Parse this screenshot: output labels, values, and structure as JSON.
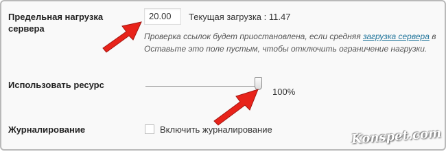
{
  "server_load": {
    "label": "Предельная нагрузка сервера",
    "value": "20.00",
    "current_load": "Текущая загрузка : 11.47",
    "desc_line1_prefix": "Проверка ссылок будет приостановлена, если средняя ",
    "desc_link": "загрузка сервера",
    "desc_line1_suffix": " в",
    "desc_line2": "Оставьте это поле пустым, чтобы отключить ограничение нагрузки."
  },
  "resource": {
    "label": "Использовать ресурс",
    "level_percent": 100,
    "value_text": "100%"
  },
  "logging": {
    "label": "Журналирование",
    "checkbox_label": "Включить журналирование",
    "checked": false
  },
  "watermark": "Konspet.com",
  "colors": {
    "arrow": "#e8231a",
    "link": "#21759b",
    "background": "#f9f9f9"
  }
}
